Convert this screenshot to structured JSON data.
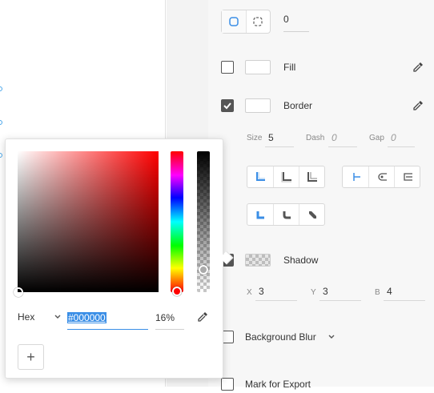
{
  "inspector": {
    "radius_value": "0",
    "fill": {
      "label": "Fill",
      "checked": false
    },
    "border": {
      "label": "Border",
      "checked": true,
      "size_label": "Size",
      "size_value": "5",
      "dash_label": "Dash",
      "dash_value": "0",
      "gap_label": "Gap",
      "gap_value": "0"
    },
    "shadow": {
      "label": "Shadow",
      "x_label": "X",
      "x_value": "3",
      "y_label": "Y",
      "y_value": "3",
      "b_label": "B",
      "b_value": "4"
    },
    "background_blur": {
      "label": "Background Blur"
    },
    "mark_export": {
      "label": "Mark for Export"
    }
  },
  "color_picker": {
    "mode": "Hex",
    "hex_value": "#000000",
    "opacity": "16%",
    "add_label": "+",
    "hue_color": "#ff0000"
  },
  "colors": {
    "accent": "#3a8ee6",
    "selection_handle": "#49a6e9"
  }
}
